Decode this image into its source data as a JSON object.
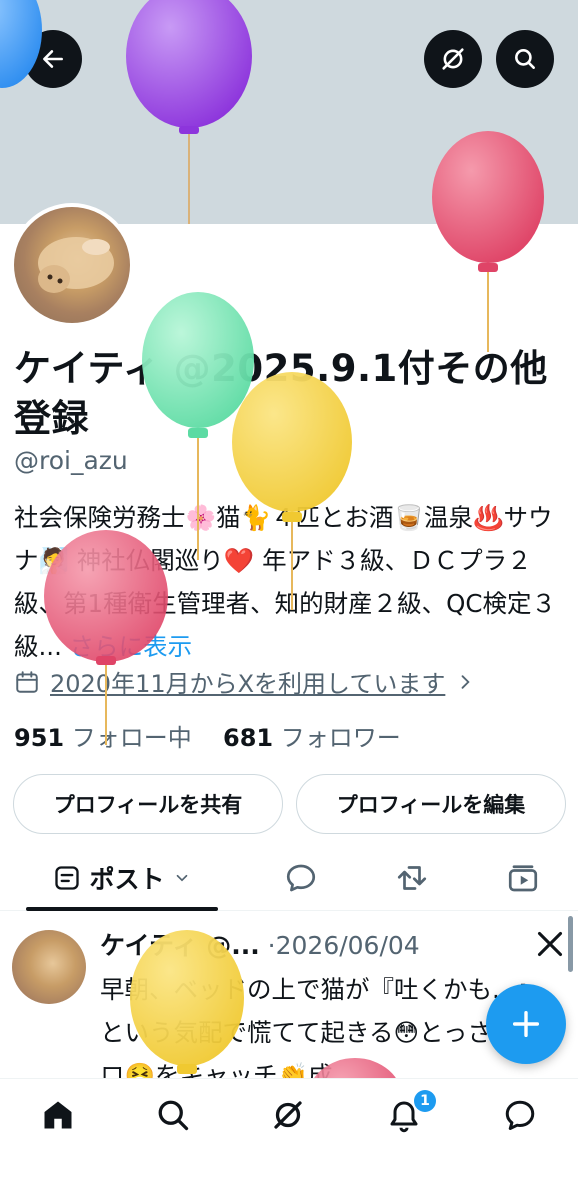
{
  "header": {
    "back_icon": "arrow-left-icon",
    "grok_icon": "grok-icon",
    "search_icon": "search-icon",
    "banner_color": "#cfd9de"
  },
  "profile": {
    "name": "ケイティ @2025.9.1付その他登録",
    "handle": "@roi_azu",
    "bio": "社会保険労務士🌸猫🐈４匹とお酒🥃温泉♨️サウナ🧖 神社仏閣巡り❤️ 年アド３級、ＤＣプラ２級、第1種衛生管理者、知的財産２級、QC検定３級...",
    "bio_more": "さらに表示",
    "joined": "2020年11月からXを利用しています",
    "following_count": "951",
    "following_label": "フォロー中",
    "followers_count": "681",
    "followers_label": "フォロワー",
    "share_button": "プロフィールを共有",
    "edit_button": "プロフィールを編集"
  },
  "tabs": {
    "posts_label": "ポスト",
    "replies_icon": "speech-bubble-icon",
    "reposts_icon": "repost-icon",
    "media_icon": "media-icon"
  },
  "post": {
    "author": "ケイティ @...",
    "separator": "·",
    "date": "2026/06/04",
    "text": "早朝、ベッドの上で猫が『吐くかも...』という気配で慌てて起きる😳とっさにゲロ🤮をキャッチ👏成"
  },
  "nav": {
    "notifications_badge": "1",
    "icons": [
      "home-icon",
      "search-icon",
      "grok-icon",
      "bell-icon",
      "chat-icon"
    ]
  },
  "accent_color": "#1d9bf0"
}
